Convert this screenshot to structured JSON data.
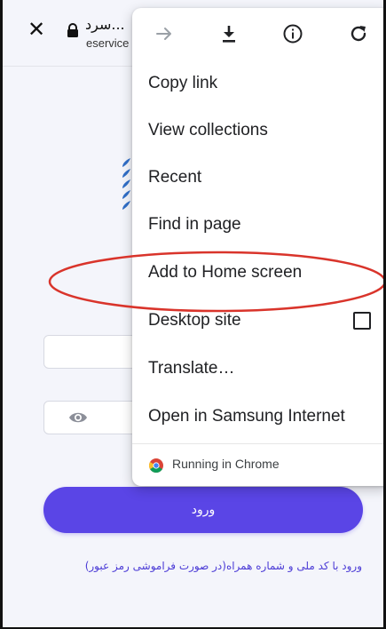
{
  "browser": {
    "tab_title": "سرد...",
    "tab_url": "eservice",
    "close_glyph": "✕"
  },
  "page": {
    "login_button": "ورود",
    "alt_login_link": "ورود با کد ملی و شماره همراه(در صورت فراموشی رمز عبور)"
  },
  "menu": {
    "toolbar_icons": [
      "forward-icon",
      "download-icon",
      "info-icon",
      "refresh-icon"
    ],
    "items": [
      {
        "label": "Copy link"
      },
      {
        "label": "View collections"
      },
      {
        "label": "Recent"
      },
      {
        "label": "Find in page"
      },
      {
        "label": "Add to Home screen"
      },
      {
        "label": "Desktop site",
        "checked": false
      },
      {
        "label": "Translate…"
      },
      {
        "label": "Open in Samsung Internet"
      }
    ],
    "footer": "Running in Chrome"
  },
  "colors": {
    "accent": "#5a45e6",
    "highlight": "#d9342b",
    "link": "#4b3bd6"
  }
}
